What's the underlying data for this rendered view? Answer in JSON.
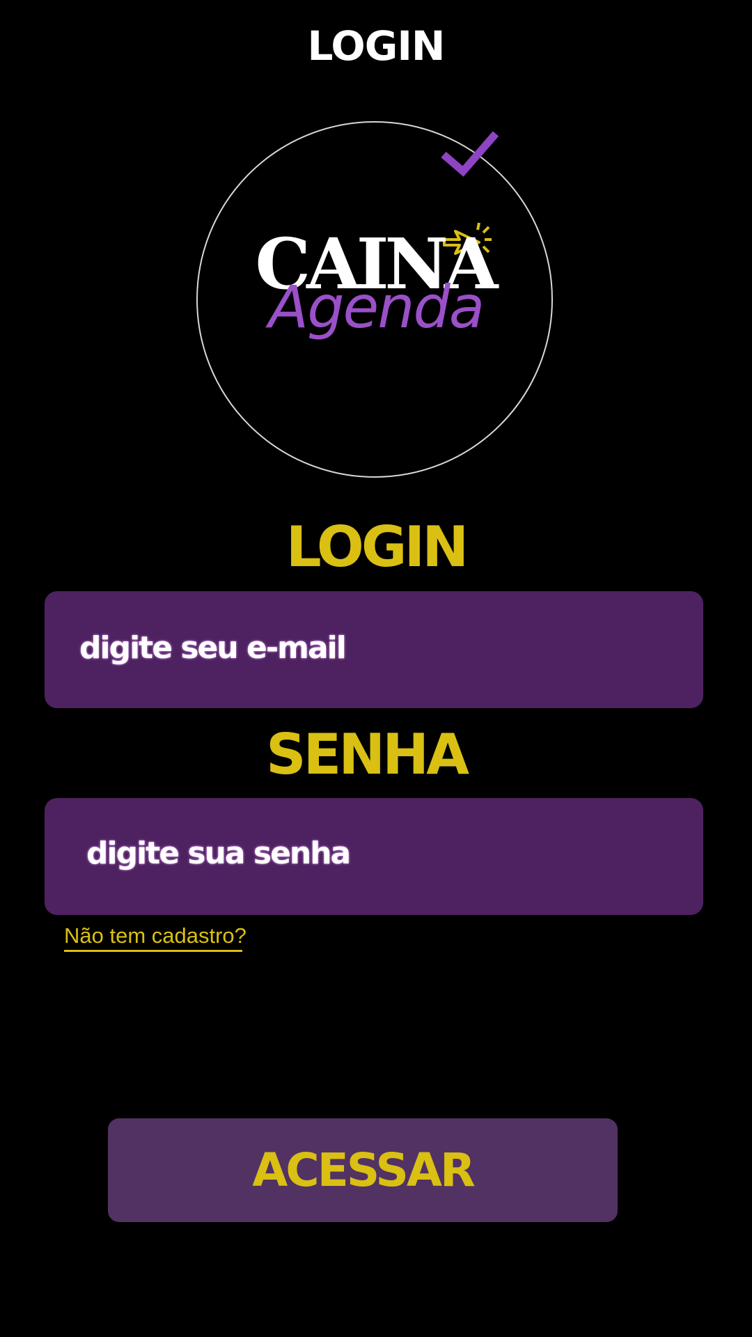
{
  "header": {
    "title": "LOGIN"
  },
  "logo": {
    "brand_top": "CAINA",
    "brand_bottom": "Agenda",
    "colors": {
      "brand_top": "#ffffff",
      "brand_bottom": "#9a50c8",
      "check": "#8e44c4",
      "cursor": "#d9c013",
      "ring": "#d8d8d8"
    }
  },
  "form": {
    "login_label": "LOGIN",
    "email_placeholder": "digite seu e-mail",
    "password_label": "SENHA",
    "password_placeholder": "digite sua senha",
    "register_link": "Não tem cadastro?",
    "submit_label": "ACESSAR"
  },
  "theme": {
    "background": "#000000",
    "accent_yellow": "#d9c013",
    "field_purple": "#4e2260",
    "button_purple": "#523262"
  }
}
